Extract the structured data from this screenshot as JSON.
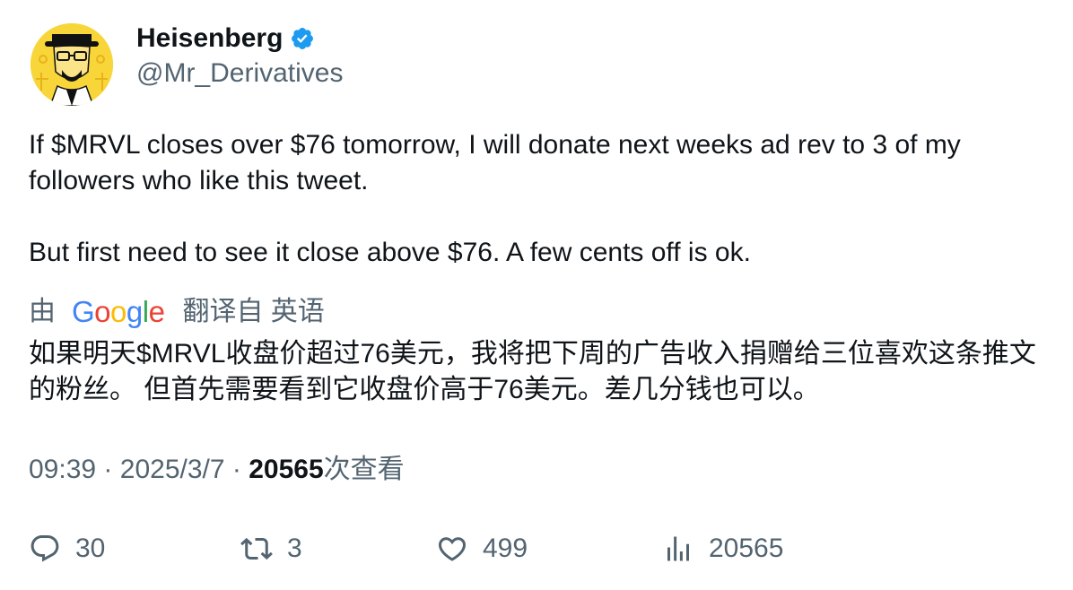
{
  "author": {
    "display_name": "Heisenberg",
    "handle": "@Mr_Derivatives",
    "verified": true,
    "avatar_icon": "heisenberg-avatar",
    "verified_color": "#1d9bf0"
  },
  "tweet": {
    "text": "If $MRVL closes over $76 tomorrow, I will donate next weeks ad rev to 3 of my followers who like this tweet.\n\nBut first need to see it close above $76. A few cents off is ok."
  },
  "translation": {
    "by_label": "由",
    "provider": "Google",
    "from_label": "翻译自 英语",
    "text": "如果明天$MRVL收盘价超过76美元，我将把下周的广告收入捐赠给三位喜欢这条推文的粉丝。 但首先需要看到它收盘价高于76美元。差几分钱也可以。"
  },
  "meta": {
    "time": "09:39",
    "separator": "·",
    "date": "2025/3/7",
    "views_count": "20565",
    "views_label": "次查看"
  },
  "actions": {
    "reply_count": "30",
    "retweet_count": "3",
    "like_count": "499",
    "views_count": "20565"
  },
  "colors": {
    "text_primary": "#0f1419",
    "text_secondary": "#536471",
    "verified": "#1d9bf0",
    "avatar_bg": "#f8d63a"
  }
}
